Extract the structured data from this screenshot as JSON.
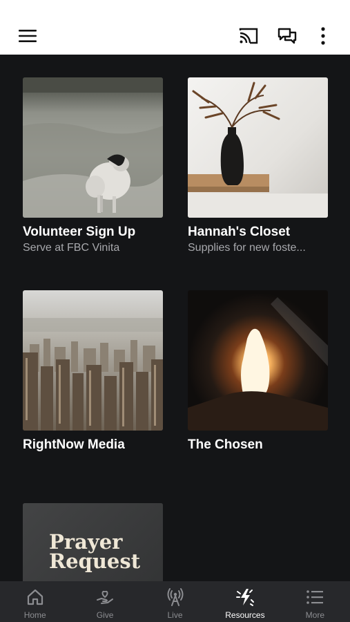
{
  "topbar": {
    "icons": [
      "menu-icon",
      "cast-icon",
      "chat-icon",
      "more-vertical-icon"
    ]
  },
  "cards": [
    {
      "title": "Volunteer Sign Up",
      "subtitle": "Serve at FBC Vinita"
    },
    {
      "title": "Hannah's Closet",
      "subtitle": "Supplies for new foste..."
    },
    {
      "title": "RightNow Media",
      "subtitle": ""
    },
    {
      "title": "The Chosen",
      "subtitle": ""
    },
    {
      "title": "",
      "subtitle": "",
      "image_text": {
        "line1": "Prayer",
        "line2": "Request"
      }
    }
  ],
  "nav": [
    {
      "label": "Home",
      "icon": "home-icon",
      "active": false
    },
    {
      "label": "Give",
      "icon": "give-icon",
      "active": false
    },
    {
      "label": "Live",
      "icon": "live-icon",
      "active": false
    },
    {
      "label": "Resources",
      "icon": "resources-icon",
      "active": true
    },
    {
      "label": "More",
      "icon": "list-icon",
      "active": false
    }
  ],
  "colors": {
    "background": "#141517",
    "topbar": "#ffffff",
    "nav_background": "#27282b",
    "nav_active": "#ffffff",
    "nav_inactive": "#8c8d91"
  }
}
